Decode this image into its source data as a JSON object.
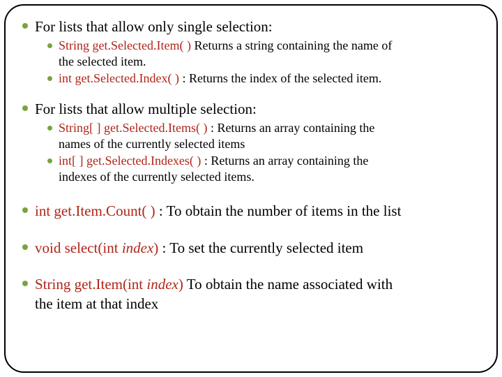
{
  "s1": {
    "heading": "For lists that allow only single selection:",
    "m1_code": "String get.Selected.Item( )",
    "m1_desc_a": "  Returns a string containing the name of",
    "m1_desc_b": "the selected item.",
    "m2_code": "int get.Selected.Index( )",
    "m2_desc": "     : Returns the index of the selected item."
  },
  "s2": {
    "heading": "For lists that allow multiple selection:",
    "m1_code": "String[ ] get.Selected.Items( )",
    "m1_desc_a": "         : Returns an array containing the",
    "m1_desc_b": "names of the currently selected items",
    "m2_code": "int[ ] get.Selected.Indexes( )",
    "m2_desc_a": "           : Returns an array containing the",
    "m2_desc_b": "indexes of the currently selected items."
  },
  "s3": {
    "code": "int get.Item.Count( )",
    "desc": " : To obtain the number of items in the list"
  },
  "s4": {
    "code_a": "void select(int ",
    "code_p": "index",
    "code_b": ")",
    "desc": "         : To set the currently selected item"
  },
  "s5": {
    "code_a": "String get.Item(int ",
    "code_p": "index",
    "code_b": ")",
    "desc_a": "  To obtain the name associated with",
    "desc_b": "the item at that index"
  }
}
